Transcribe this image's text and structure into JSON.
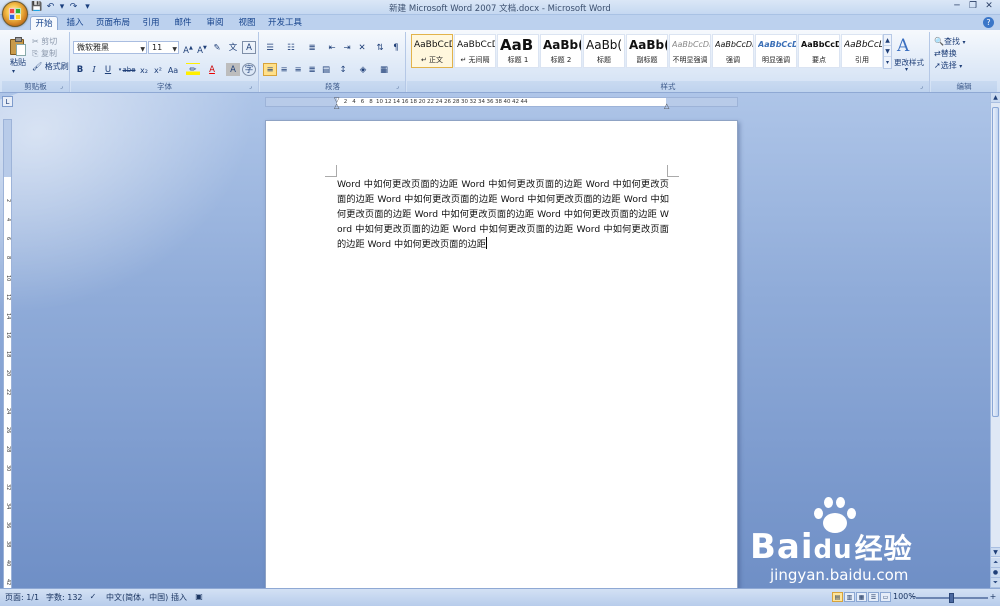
{
  "window": {
    "title": "新建 Microsoft Word 2007 文档.docx - Microsoft Word",
    "qat_dropdown": "▾"
  },
  "tabs": [
    "开始",
    "插入",
    "页面布局",
    "引用",
    "邮件",
    "审阅",
    "视图",
    "开发工具"
  ],
  "ribbon": {
    "clipboard": {
      "label": "剪贴板",
      "paste": "粘贴",
      "cut": "剪切",
      "copy": "复制",
      "format_painter": "格式刷"
    },
    "font": {
      "label": "字体",
      "font_name": "微软雅黑",
      "font_size": "11",
      "bold": "B",
      "italic": "I",
      "underline": "U",
      "strike": "abe",
      "sub": "x₂",
      "sup": "x²",
      "case": "Aa"
    },
    "paragraph": {
      "label": "段落"
    },
    "styles": {
      "label": "样式",
      "items": [
        {
          "preview": "AaBbCcD",
          "name": "↵ 正文"
        },
        {
          "preview": "AaBbCcD",
          "name": "↵ 无间隔"
        },
        {
          "preview": "AaB",
          "name": "标题 1"
        },
        {
          "preview": "AaBb(",
          "name": "标题 2"
        },
        {
          "preview": "AaBb(",
          "name": "标题"
        },
        {
          "preview": "AaBb(",
          "name": "副标题"
        },
        {
          "preview": "AaBbCcDi",
          "name": "不明显强调"
        },
        {
          "preview": "AaBbCcDi",
          "name": "强调"
        },
        {
          "preview": "AaBbCcDi",
          "name": "明显强调"
        },
        {
          "preview": "AaBbCcDc",
          "name": "要点"
        },
        {
          "preview": "AaBbCcL",
          "name": "引用"
        }
      ],
      "change_styles": "更改样式"
    },
    "editing": {
      "label": "编辑",
      "find": "查找",
      "replace": "替换",
      "select": "选择"
    }
  },
  "ruler": {
    "ticks": [
      "2",
      "4",
      "6",
      "8",
      "10",
      "12",
      "14",
      "16",
      "18",
      "20",
      "22",
      "24",
      "26",
      "28",
      "30",
      "32",
      "34",
      "36",
      "38",
      "40",
      "42",
      "44"
    ]
  },
  "document": {
    "body": "Word 中如何更改页面的边距 Word 中如何更改页面的边距 Word 中如何更改页面的边距 Word 中如何更改页面的边距 Word 中如何更改页面的边距 Word 中如何更改页面的边距 Word 中如何更改页面的边距 Word 中如何更改页面的边距 Word 中如何更改页面的边距 Word 中如何更改页面的边距 Word 中如何更改页面的边距 Word 中如何更改页面的边距"
  },
  "status": {
    "page": "页面: 1/1",
    "words": "字数: 132",
    "language": "中文(简体，中国)",
    "mode": "插入",
    "zoom": "100%",
    "zoom_level": 1.0
  },
  "watermark": {
    "brand": "Bai",
    "brand_du": "du",
    "brand_cn": "经验",
    "url": "jingyan.baidu.com"
  }
}
